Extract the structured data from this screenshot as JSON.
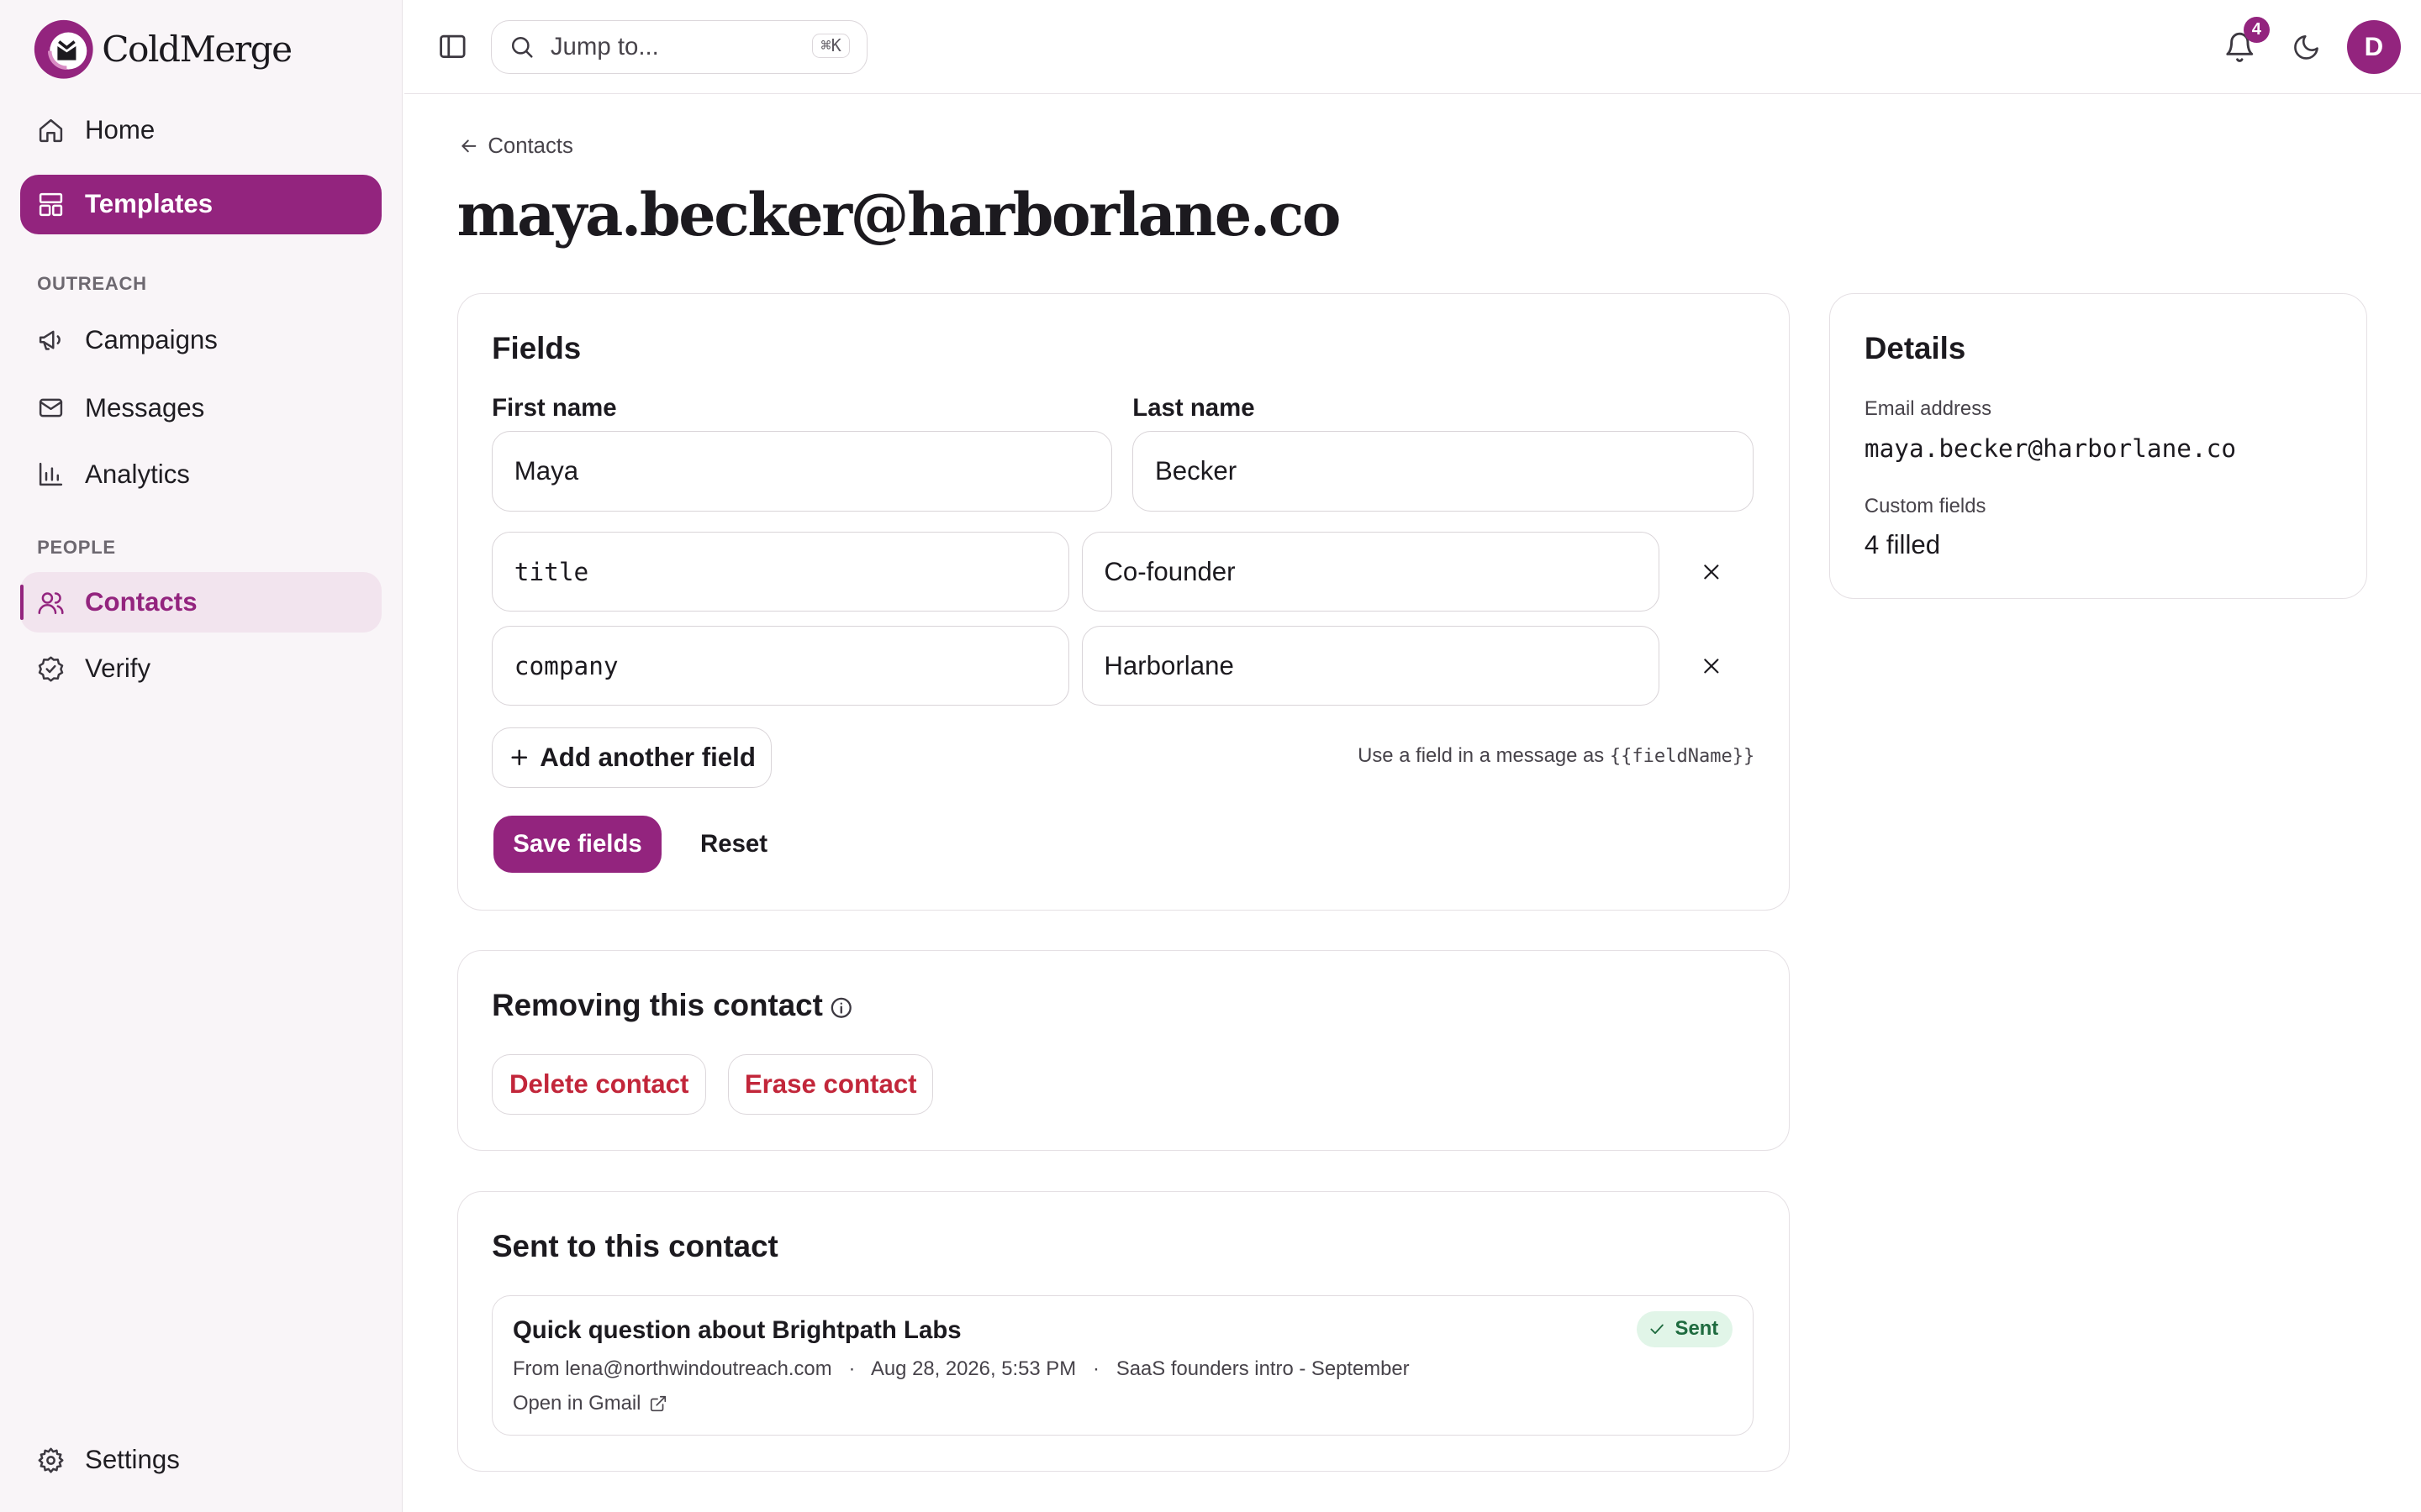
{
  "brand": {
    "name": "ColdMerge",
    "accent": "#93247e"
  },
  "sidebar": {
    "items": [
      {
        "label": "Home",
        "icon": "home-icon"
      },
      {
        "label": "Templates",
        "icon": "templates-icon"
      }
    ],
    "sections": [
      {
        "label": "OUTREACH",
        "items": [
          {
            "label": "Campaigns",
            "icon": "megaphone-icon"
          },
          {
            "label": "Messages",
            "icon": "mail-icon"
          },
          {
            "label": "Analytics",
            "icon": "bar-chart-icon"
          }
        ]
      },
      {
        "label": "PEOPLE",
        "items": [
          {
            "label": "Contacts",
            "icon": "users-icon"
          },
          {
            "label": "Verify",
            "icon": "badge-check-icon"
          }
        ]
      }
    ],
    "settings_label": "Settings"
  },
  "topbar": {
    "search_placeholder": "Jump to...",
    "search_shortcut": "⌘K",
    "notification_count": "4",
    "avatar_initial": "D"
  },
  "breadcrumb": {
    "back_label": "Contacts"
  },
  "page": {
    "title": "maya.becker@harborlane.co"
  },
  "fields_card": {
    "title": "Fields",
    "first_name_label": "First name",
    "first_name_value": "Maya",
    "last_name_label": "Last name",
    "last_name_value": "Becker",
    "custom_fields": [
      {
        "key": "title",
        "value": "Co-founder"
      },
      {
        "key": "company",
        "value": "Harborlane"
      }
    ],
    "add_field_label": "Add another field",
    "hint_prefix": "Use a field in a message as",
    "hint_code": "{{fieldName}}",
    "save_label": "Save fields",
    "reset_label": "Reset"
  },
  "removing_card": {
    "title": "Removing this contact",
    "delete_label": "Delete contact",
    "erase_label": "Erase contact"
  },
  "sent_card": {
    "title": "Sent to this contact",
    "messages": [
      {
        "subject": "Quick question about Brightpath Labs",
        "status": "Sent",
        "from": "From lena@northwindoutreach.com",
        "date": "Aug 28, 2026, 5:53 PM",
        "campaign": "SaaS founders intro - September",
        "link_label": "Open in Gmail"
      }
    ]
  },
  "details_card": {
    "title": "Details",
    "email_label": "Email address",
    "email_value": "maya.becker@harborlane.co",
    "custom_fields_label": "Custom fields",
    "custom_fields_value": "4 filled"
  }
}
